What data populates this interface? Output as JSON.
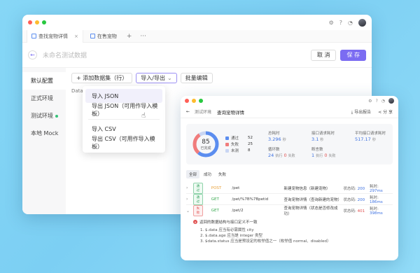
{
  "main": {
    "tabs": [
      {
        "label": "查找宠物详情",
        "close": "×"
      },
      {
        "label": "在售宠物"
      }
    ],
    "tab_add": "+",
    "tab_more": "···",
    "doc_title": "未命名测试数据",
    "cancel_label": "取 消",
    "save_label": "保 存",
    "envs": [
      {
        "label": "默认配置"
      },
      {
        "label": "正式环境"
      },
      {
        "label": "测试环境"
      },
      {
        "label": "本地 Mock"
      }
    ],
    "toolbar": {
      "add_dataset": "+ 添加数据集（行）",
      "import_export": "导入/导出",
      "import_export_arrow": "⌄",
      "batch_edit": "批量编辑"
    },
    "data_label": "Data",
    "dropdown": [
      "导入 JSON",
      "导出 JSON（可用作导入模板）",
      "导入 CSV",
      "导出 CSV（可用作导入模板）"
    ]
  },
  "report": {
    "back": "←",
    "label": "测试环境",
    "title": "查询宠物详情",
    "export": "导出报告",
    "share": "分 享",
    "donut": {
      "percent": "85",
      "sub": "已完成"
    },
    "legend": [
      {
        "name": "通过",
        "value": "52",
        "color": "#5b8def"
      },
      {
        "name": "失败",
        "value": "25",
        "color": "#f07c7c"
      },
      {
        "name": "未测",
        "value": "8",
        "color": "#c9d6f3"
      }
    ],
    "metrics": {
      "total_time_label": "总耗时",
      "total_time": "3.296",
      "total_time_unit": "秒",
      "api_time_label": "接口请求耗时",
      "api_time": "3.1",
      "api_time_unit": "秒",
      "avg_time_label": "平均接口请求耗时",
      "avg_time": "517.17",
      "avg_time_unit": "秒",
      "loops_label": "循环数",
      "loops_exec": "24",
      "loops_exec_unit": "执行",
      "loops_fail": "0",
      "loops_fail_unit": "失败",
      "assert_label": "断言数",
      "assert_exec": "1",
      "assert_exec_unit": "执行",
      "assert_fail": "0",
      "assert_fail_unit": "失败"
    },
    "filters": [
      "全部",
      "成功",
      "失败"
    ],
    "rows": [
      {
        "status": "通过",
        "method": "POST",
        "path": "/pet",
        "desc": "新建宠物信息（新建宠物）",
        "code_label": "状态码:",
        "code": "200",
        "time_label": "耗时:",
        "time": "297ms",
        "chev": "›"
      },
      {
        "status": "通过",
        "method": "GET",
        "path": "/pet/%7B%7Bpetid",
        "desc": "查询宠物详情（查询新建的宠物）",
        "code_label": "状态码:",
        "code": "200",
        "time_label": "耗时:",
        "time": "186ms",
        "chev": "›"
      },
      {
        "status": "失败",
        "method": "GET",
        "path": "/pet/2",
        "desc": "查询宠物详情（状态是否修改成功）",
        "code_label": "状态码:",
        "code": "401",
        "time_label": "耗时:",
        "time": "398ms",
        "chev": "⌄"
      }
    ],
    "error": {
      "head": "返回的数据结构与接口定义不一致",
      "lines": [
        "1. $.data 应当有必需属性 city",
        "2. $.data.age 应当是 integer 类型",
        "3. $data.status 应当是预设定的枚举值之一（枚举值 normal、disabled）"
      ]
    }
  }
}
